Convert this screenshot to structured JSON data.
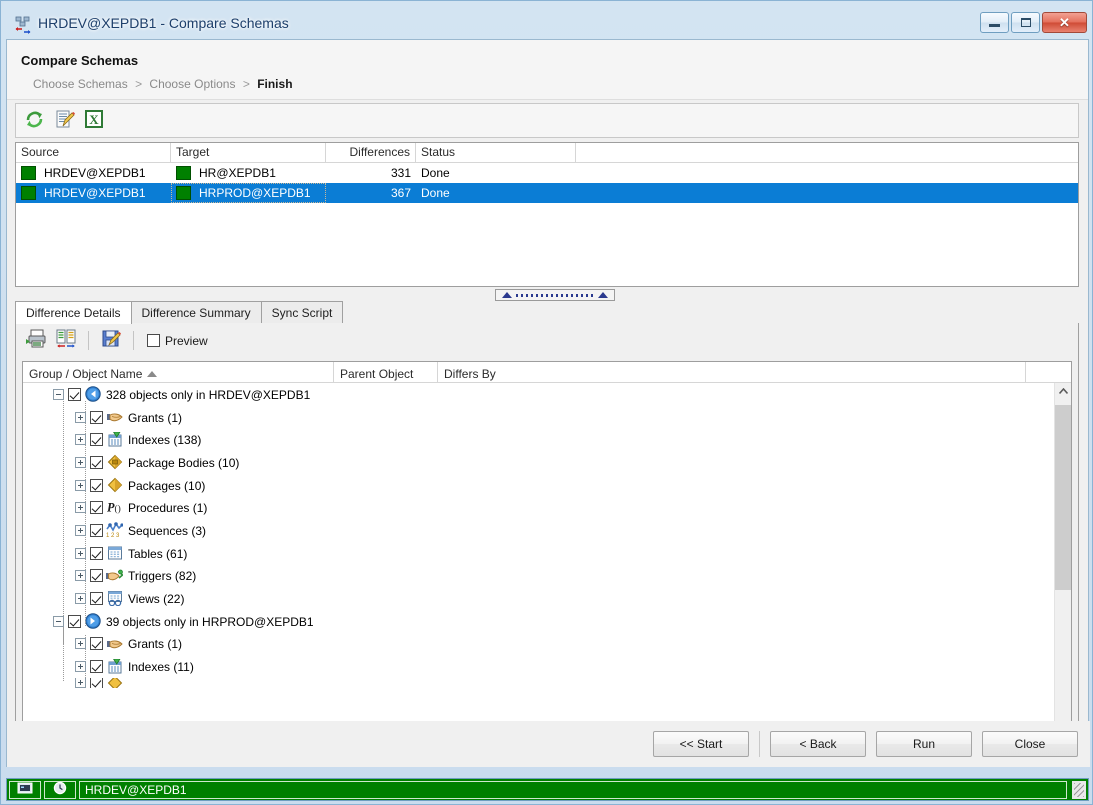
{
  "window": {
    "title": "HRDEV@XEPDB1 - Compare Schemas",
    "icon": "compare-schemas-icon",
    "controls": {
      "minimize": "minimize-icon",
      "maximize": "maximize-icon",
      "close": "✕"
    }
  },
  "wizard": {
    "title": "Compare Schemas",
    "breadcrumb": [
      {
        "label": "Choose Schemas",
        "active": false
      },
      {
        "label": "Choose Options",
        "active": false
      },
      {
        "label": "Finish",
        "active": true
      }
    ],
    "separator": ">"
  },
  "toolbar_top": {
    "buttons": [
      {
        "name": "refresh-icon",
        "tooltip": "Refresh"
      },
      {
        "name": "edit-report-icon",
        "tooltip": "Edit"
      },
      {
        "name": "export-excel-icon",
        "tooltip": "Export to Excel"
      }
    ]
  },
  "compare_grid": {
    "columns": [
      "Source",
      "Target",
      "Differences",
      "Status"
    ],
    "rows": [
      {
        "source": "HRDEV@XEPDB1",
        "target": "HR@XEPDB1",
        "differences": "331",
        "status": "Done",
        "selected": false,
        "source_color": "#008000",
        "target_color": "#008000"
      },
      {
        "source": "HRDEV@XEPDB1",
        "target": "HRPROD@XEPDB1",
        "differences": "367",
        "status": "Done",
        "selected": true,
        "source_color": "#008000",
        "target_color": "#008000"
      }
    ]
  },
  "tabs": [
    {
      "label": "Difference Details",
      "active": true
    },
    {
      "label": "Difference Summary",
      "active": false
    },
    {
      "label": "Sync Script",
      "active": false
    }
  ],
  "toolbar_sub": {
    "buttons": [
      {
        "name": "print-report-icon",
        "tooltip": "Print"
      },
      {
        "name": "compare-side-by-side-icon",
        "tooltip": "Compare"
      },
      {
        "name": "save-script-icon",
        "tooltip": "Save"
      }
    ],
    "preview_checkbox": {
      "label": "Preview",
      "checked": false
    }
  },
  "tree": {
    "columns": [
      "Group / Object Name",
      "Parent Object",
      "Differs By"
    ],
    "sort_column": "Group / Object Name",
    "sort_direction": "asc",
    "rows": [
      {
        "level": 0,
        "expander": "minus",
        "checked": true,
        "icon": "arrow-left-blue-icon",
        "label": "328 objects only in HRDEV@XEPDB1"
      },
      {
        "level": 1,
        "expander": "plus",
        "checked": true,
        "icon": "grants-icon",
        "label": "Grants (1)"
      },
      {
        "level": 1,
        "expander": "plus",
        "checked": true,
        "icon": "indexes-icon",
        "label": "Indexes (138)"
      },
      {
        "level": 1,
        "expander": "plus",
        "checked": true,
        "icon": "package-body-icon",
        "label": "Package Bodies (10)"
      },
      {
        "level": 1,
        "expander": "plus",
        "checked": true,
        "icon": "package-icon",
        "label": "Packages (10)"
      },
      {
        "level": 1,
        "expander": "plus",
        "checked": true,
        "icon": "procedure-icon",
        "label": "Procedures (1)"
      },
      {
        "level": 1,
        "expander": "plus",
        "checked": true,
        "icon": "sequence-icon",
        "label": "Sequences (3)"
      },
      {
        "level": 1,
        "expander": "plus",
        "checked": true,
        "icon": "table-icon",
        "label": "Tables (61)"
      },
      {
        "level": 1,
        "expander": "plus",
        "checked": true,
        "icon": "trigger-icon",
        "label": "Triggers (82)"
      },
      {
        "level": 1,
        "expander": "plus",
        "checked": true,
        "icon": "view-icon",
        "label": "Views (22)"
      },
      {
        "level": 0,
        "expander": "minus",
        "checked": true,
        "icon": "arrow-right-blue-icon",
        "label": "39 objects only in HRPROD@XEPDB1"
      },
      {
        "level": 1,
        "expander": "plus",
        "checked": true,
        "icon": "grants-icon",
        "label": "Grants (1)"
      },
      {
        "level": 1,
        "expander": "plus",
        "checked": true,
        "icon": "indexes-icon",
        "label": "Indexes (11)"
      }
    ]
  },
  "footer": {
    "buttons": [
      {
        "label": "<< Start",
        "name": "start-button"
      },
      {
        "label": "< Back",
        "name": "back-button"
      },
      {
        "label": "Run",
        "name": "run-button"
      },
      {
        "label": "Close",
        "name": "close-button"
      }
    ]
  },
  "statusbar": {
    "connection": "HRDEV@XEPDB1",
    "background_color": "#008000",
    "panes": [
      "db-icon",
      "clock-icon"
    ]
  }
}
